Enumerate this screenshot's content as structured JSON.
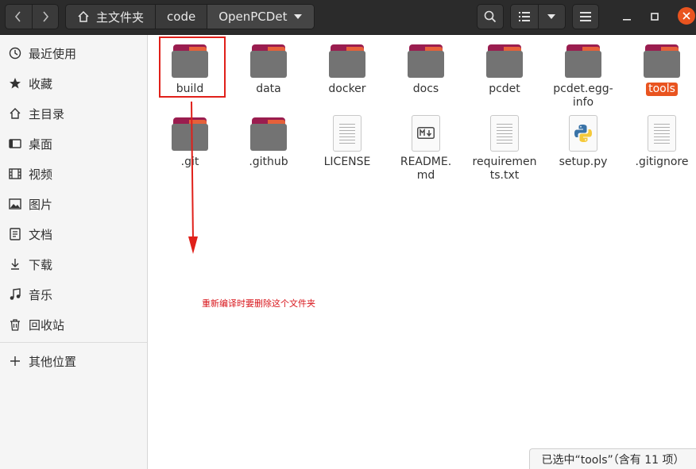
{
  "header": {
    "breadcrumbs": [
      {
        "label": "主文件夹",
        "icon": "home-icon"
      },
      {
        "label": "code"
      },
      {
        "label": "OpenPCDet",
        "icon": "chevron-down-icon"
      }
    ]
  },
  "sidebar": {
    "items": [
      {
        "label": "最近使用",
        "icon": "clock-icon"
      },
      {
        "label": "收藏",
        "icon": "star-icon"
      },
      {
        "label": "主目录",
        "icon": "home-icon"
      },
      {
        "label": "桌面",
        "icon": "desktop-icon"
      },
      {
        "label": "视频",
        "icon": "video-icon"
      },
      {
        "label": "图片",
        "icon": "image-icon"
      },
      {
        "label": "文档",
        "icon": "document-icon"
      },
      {
        "label": "下载",
        "icon": "download-icon"
      },
      {
        "label": "音乐",
        "icon": "music-icon"
      },
      {
        "label": "回收站",
        "icon": "trash-icon"
      },
      {
        "label": "其他位置",
        "icon": "plus-icon"
      }
    ]
  },
  "files": [
    {
      "name": "build",
      "type": "folder"
    },
    {
      "name": "data",
      "type": "folder"
    },
    {
      "name": "docker",
      "type": "folder"
    },
    {
      "name": "docs",
      "type": "folder"
    },
    {
      "name": "pcdet",
      "type": "folder"
    },
    {
      "name": "pcdet.egg-\ninfo",
      "type": "folder"
    },
    {
      "name": "tools",
      "type": "folder",
      "selected": true
    },
    {
      "name": ".git",
      "type": "folder"
    },
    {
      "name": ".github",
      "type": "folder"
    },
    {
      "name": "LICENSE",
      "type": "text"
    },
    {
      "name": "README.\nmd",
      "type": "markdown"
    },
    {
      "name": "requiremen\nts.txt",
      "type": "text"
    },
    {
      "name": "setup.py",
      "type": "python"
    },
    {
      "name": ".gitignore",
      "type": "text"
    }
  ],
  "status": {
    "text": "已选中“tools”（含有 11 项）"
  },
  "annotation": {
    "text": "重新编译时要删除这个文件夹",
    "color": "#e0201a"
  },
  "colors": {
    "accent": "#e95420",
    "header": "#2b2b2b"
  }
}
